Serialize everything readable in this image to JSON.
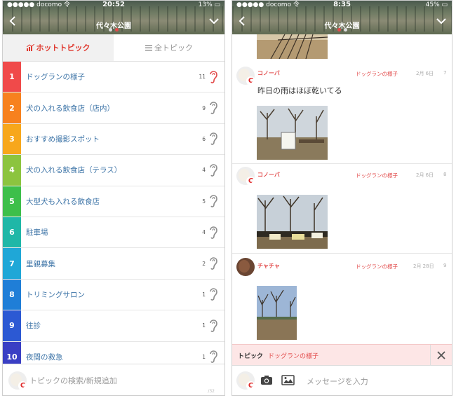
{
  "left": {
    "status": {
      "carrier": "●●●●● docomo 令",
      "time": "20:52",
      "battery": "13% ▭"
    },
    "nav_title": "代々木公園",
    "tabs": {
      "hot": "ホットトピック",
      "all": "全トピック"
    },
    "topics": [
      {
        "rank": "1",
        "label": "ドッグランの様子",
        "count": "11",
        "color": "#f04a4a"
      },
      {
        "rank": "2",
        "label": "犬の入れる飲食店（店内）",
        "count": "9",
        "color": "#f7811e"
      },
      {
        "rank": "3",
        "label": "おすすめ撮影スポット",
        "count": "6",
        "color": "#f7a71c"
      },
      {
        "rank": "4",
        "label": "犬の入れる飲食店（テラス）",
        "count": "4",
        "color": "#8cc43f"
      },
      {
        "rank": "5",
        "label": "大型犬も入れる飲食店",
        "count": "5",
        "color": "#3dbf4a"
      },
      {
        "rank": "6",
        "label": "駐車場",
        "count": "4",
        "color": "#1fb7a7"
      },
      {
        "rank": "7",
        "label": "里親募集",
        "count": "2",
        "color": "#1fa7d7"
      },
      {
        "rank": "8",
        "label": "トリミングサロン",
        "count": "1",
        "color": "#1f7ed7"
      },
      {
        "rank": "9",
        "label": "往診",
        "count": "1",
        "color": "#2c59d3"
      },
      {
        "rank": "10",
        "label": "夜間の救急",
        "count": "1",
        "color": "#3a3fc4"
      }
    ],
    "search_placeholder": "トピックの検索/新規追加",
    "pager": "/32"
  },
  "right": {
    "status": {
      "carrier": "●●●●● docomo 令",
      "time": "8:35",
      "battery": "45% ▭"
    },
    "nav_title": "代々木公園",
    "messages": [
      {
        "user": "コノーバ",
        "topic": "ドッグランの様子",
        "date": "2月 6日",
        "num": "7",
        "text": "昨日の雨はほぼ乾いてる"
      },
      {
        "user": "コノーバ",
        "topic": "ドッグランの様子",
        "date": "2月 6日",
        "num": "8",
        "text": ""
      },
      {
        "user": "チャチャ",
        "topic": "ドッグランの様子",
        "date": "2月 28日",
        "num": "9",
        "text": ""
      }
    ],
    "topic_bar": {
      "label": "トピック",
      "value": "ドッグランの様子"
    },
    "message_placeholder": "メッセージを入力"
  },
  "colors": {
    "accent": "#e24b4b",
    "link": "#3a72a6"
  }
}
